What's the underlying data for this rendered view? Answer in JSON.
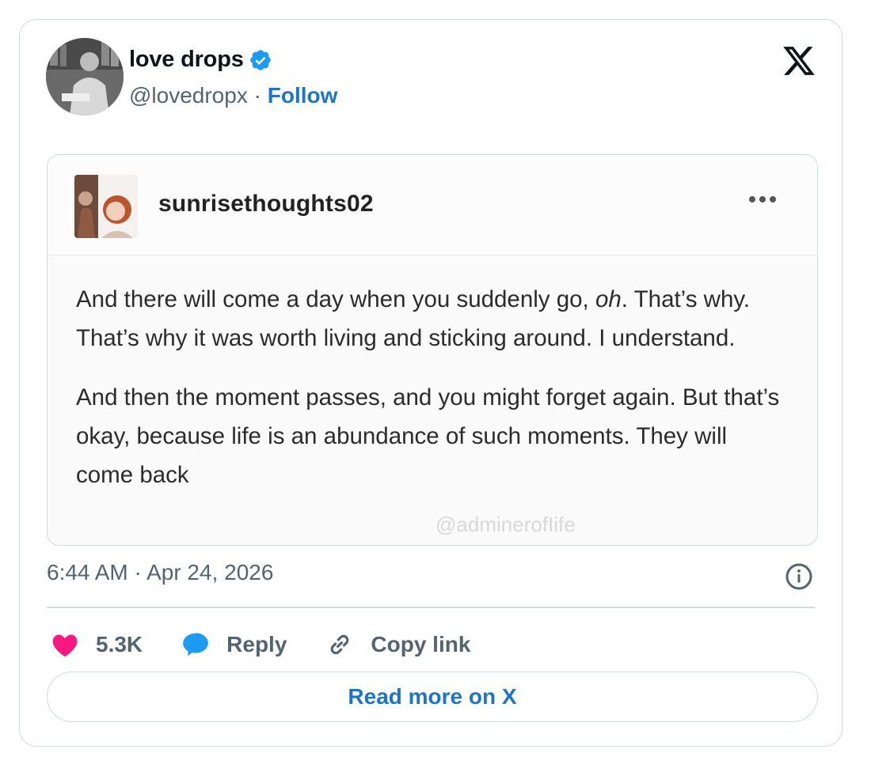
{
  "author": {
    "name": "love drops",
    "handle": "@lovedropx",
    "separator": "·",
    "follow_label": "Follow"
  },
  "icons": {
    "verified": "verified-badge-icon",
    "brand": "x-logo-icon",
    "more": "more-dots-icon",
    "info": "info-icon",
    "like": "heart-icon",
    "reply": "reply-bubble-icon",
    "copy": "link-icon"
  },
  "quote": {
    "username": "sunrisethoughts02",
    "paragraph1_a": "And there will come a day when you suddenly go, ",
    "paragraph1_em": "oh",
    "paragraph1_b": ". That’s why. That’s why it was worth living and sticking around. I understand.",
    "paragraph2": "And then the moment passes, and you might forget again. But that’s okay, because life is an abundance of such moments. They will come back",
    "watermark": "@adminerofIife"
  },
  "timestamp": "6:44 AM · Apr 24, 2026",
  "actions": {
    "like_count": "5.3K",
    "reply_label": "Reply",
    "copy_label": "Copy link"
  },
  "read_more_label": "Read more on X",
  "colors": {
    "accent": "#1d74c9",
    "verified": "#1d9bf0",
    "heart": "#f91880",
    "border": "#cfd9de",
    "muted": "#536471"
  }
}
